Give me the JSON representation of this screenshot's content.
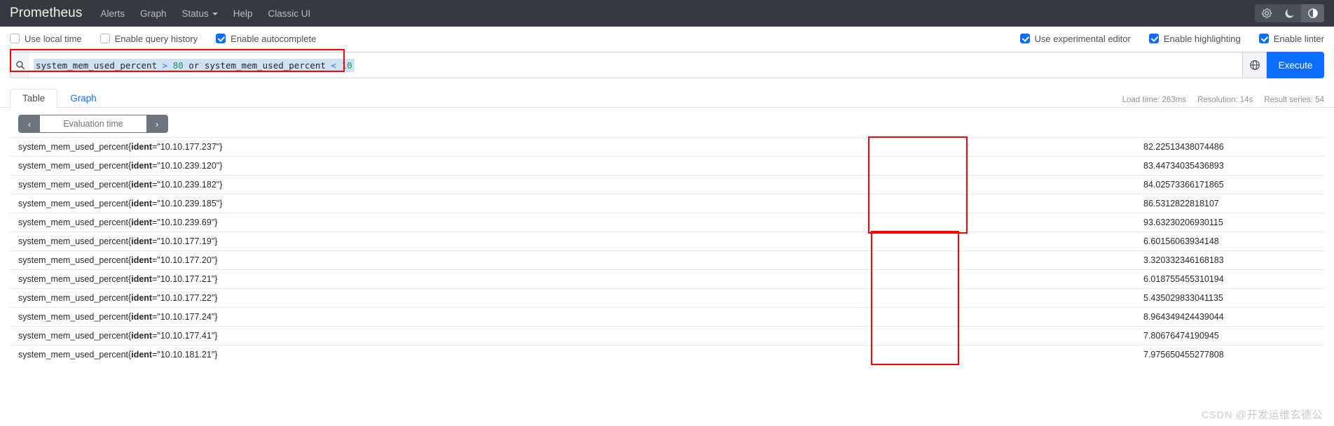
{
  "navbar": {
    "brand": "Prometheus",
    "links": [
      {
        "label": "Alerts",
        "has_caret": false
      },
      {
        "label": "Graph",
        "has_caret": false
      },
      {
        "label": "Status",
        "has_caret": true
      },
      {
        "label": "Help",
        "has_caret": false
      },
      {
        "label": "Classic UI",
        "has_caret": false
      }
    ],
    "theme_buttons": [
      {
        "icon": "gear-icon",
        "glyph": "⚙",
        "active": false
      },
      {
        "icon": "moon-icon",
        "glyph": "☾",
        "active": false
      },
      {
        "icon": "half-circle-icon",
        "glyph": "◑",
        "active": true
      }
    ]
  },
  "options": {
    "left": [
      {
        "label": "Use local time",
        "checked": false
      },
      {
        "label": "Enable query history",
        "checked": false
      },
      {
        "label": "Enable autocomplete",
        "checked": true
      }
    ],
    "right": [
      {
        "label": "Use experimental editor",
        "checked": true
      },
      {
        "label": "Enable highlighting",
        "checked": true
      },
      {
        "label": "Enable linter",
        "checked": true
      }
    ]
  },
  "query": {
    "search_icon": "search-icon",
    "globe_icon": "globe-icon",
    "execute_label": "Execute",
    "tokens": [
      {
        "text": "system_mem_used_percent ",
        "type": "metric"
      },
      {
        "text": "> ",
        "type": "op"
      },
      {
        "text": "80",
        "type": "num"
      },
      {
        "text": " or ",
        "type": "kw"
      },
      {
        "text": "system_mem_used_percent ",
        "type": "metric"
      },
      {
        "text": "< ",
        "type": "op"
      },
      {
        "text": "10",
        "type": "num"
      }
    ],
    "full_text": "system_mem_used_percent > 80 or system_mem_used_percent < 10"
  },
  "tabs": [
    {
      "label": "Table",
      "active": true
    },
    {
      "label": "Graph",
      "active": false
    }
  ],
  "meta": {
    "load_time": "Load time: 263ms",
    "resolution": "Resolution: 14s",
    "result_series": "Result series: 54"
  },
  "evaluation_time": {
    "prev_label": "‹",
    "next_label": "›",
    "placeholder": "Evaluation time"
  },
  "results": {
    "metric_name": "system_mem_used_percent",
    "label_key": "ident",
    "rows": [
      {
        "ident": "10.10.177.237",
        "value": "82.22513438074486"
      },
      {
        "ident": "10.10.239.120",
        "value": "83.44734035436893"
      },
      {
        "ident": "10.10.239.182",
        "value": "84.02573366171865"
      },
      {
        "ident": "10.10.239.185",
        "value": "86.5312822818107"
      },
      {
        "ident": "10.10.239.69",
        "value": "93.63230206930115"
      },
      {
        "ident": "10.10.177.19",
        "value": "6.60156063934148"
      },
      {
        "ident": "10.10.177.20",
        "value": "3.320332346168183"
      },
      {
        "ident": "10.10.177.21",
        "value": "6.018755455310194"
      },
      {
        "ident": "10.10.177.22",
        "value": "5.435029833041135"
      },
      {
        "ident": "10.10.177.24",
        "value": "8.964349424439044"
      },
      {
        "ident": "10.10.177.41",
        "value": "7.80676474190945"
      },
      {
        "ident": "10.10.181.21",
        "value": "7.975650455277808"
      }
    ]
  },
  "watermark": {
    "csdn": "CSDN",
    "author": "@开发运维玄德公"
  },
  "colors": {
    "navbar_bg": "#343a40",
    "accent": "#0d6efd",
    "annotation": "#ff0000",
    "highlight_bg": "#cfe2f3",
    "number_token": "#1a9e5a"
  }
}
